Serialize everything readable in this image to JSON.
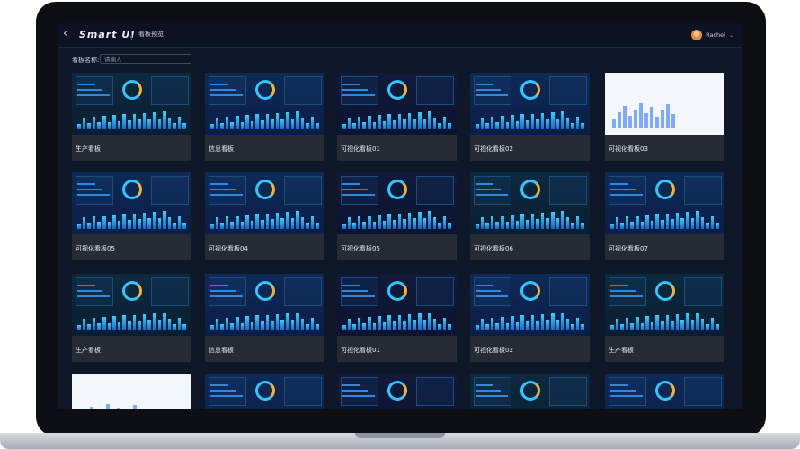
{
  "header": {
    "back_icon": "back-arrow-icon",
    "logo_text": "Smart UI",
    "page_title": "看板预览",
    "user": {
      "name": "Rachel",
      "avatar_icon": "user-avatar-icon",
      "dropdown_icon": "chevron-down-icon"
    }
  },
  "search": {
    "label": "看板名称:",
    "placeholder": "请输入",
    "value": ""
  },
  "dashboards": [
    {
      "label": "生产看板",
      "theme": "dark"
    },
    {
      "label": "信息看板",
      "theme": "blue"
    },
    {
      "label": "可视化看板01",
      "theme": "navy"
    },
    {
      "label": "可视化看板02",
      "theme": "blue"
    },
    {
      "label": "可视化看板03",
      "theme": "light"
    },
    {
      "label": "可视化看板05",
      "theme": "blue"
    },
    {
      "label": "可视化看板04",
      "theme": "blue"
    },
    {
      "label": "可视化看板05",
      "theme": "navy"
    },
    {
      "label": "可视化看板06",
      "theme": "dark"
    },
    {
      "label": "可视化看板07",
      "theme": "blue"
    },
    {
      "label": "生产看板",
      "theme": "dark"
    },
    {
      "label": "信息看板",
      "theme": "blue"
    },
    {
      "label": "可视化看板01",
      "theme": "navy"
    },
    {
      "label": "可视化看板02",
      "theme": "blue"
    },
    {
      "label": "生产看板",
      "theme": "dark"
    },
    {
      "label": "",
      "theme": "light"
    },
    {
      "label": "",
      "theme": "blue"
    },
    {
      "label": "",
      "theme": "navy"
    },
    {
      "label": "",
      "theme": "dark"
    },
    {
      "label": "",
      "theme": "blue"
    }
  ],
  "colors": {
    "accent": "#2ec7ff",
    "background": "#0f1828",
    "card": "#262b35"
  }
}
